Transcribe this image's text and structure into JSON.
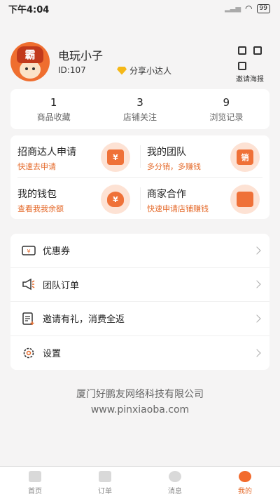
{
  "status_bar": {
    "time": "下午4:04",
    "battery": "99"
  },
  "profile": {
    "username": "电玩小子",
    "user_id": "ID:107",
    "badge_label": "分享小达人",
    "avatar_text": "霸",
    "poster_label": "邀请海报"
  },
  "stats": [
    {
      "count": "1",
      "label": "商品收藏"
    },
    {
      "count": "3",
      "label": "店铺关注"
    },
    {
      "count": "9",
      "label": "浏览记录"
    }
  ],
  "features": [
    {
      "title": "招商达人申请",
      "subtitle": "快速去申请",
      "icon_text": "¥"
    },
    {
      "title": "我的团队",
      "subtitle": "多分销，多赚钱",
      "icon_text": "销"
    },
    {
      "title": "我的钱包",
      "subtitle": "查看我我余额",
      "icon_text": "¥"
    },
    {
      "title": "商家合作",
      "subtitle": "快速申请店铺赚钱",
      "icon_text": ""
    }
  ],
  "menu": [
    {
      "label": "优惠券"
    },
    {
      "label": "团队订单"
    },
    {
      "label": "邀请有礼，消费全返"
    },
    {
      "label": "设置"
    }
  ],
  "company": {
    "name": "厦门好鹏友网络科技有限公司",
    "website": "www.pinxiaoba.com"
  },
  "tabs": [
    {
      "label": "首页"
    },
    {
      "label": "订单"
    },
    {
      "label": "消息"
    },
    {
      "label": "我的"
    }
  ],
  "colors": {
    "accent": "#e56b2c",
    "accent_light": "#fde2d4"
  }
}
